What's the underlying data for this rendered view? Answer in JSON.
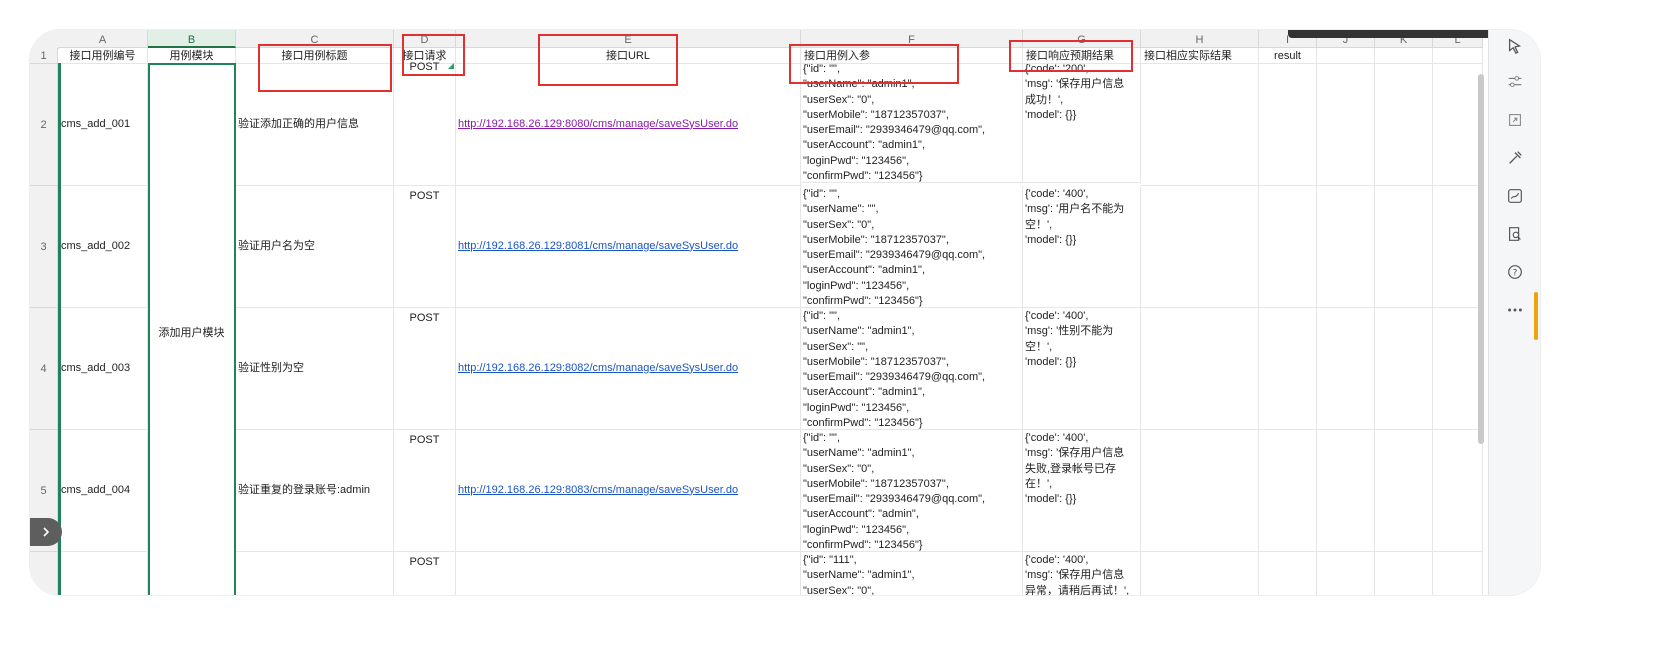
{
  "columns": [
    "A",
    "B",
    "C",
    "D",
    "E",
    "F",
    "G",
    "H",
    "I",
    "J",
    "K",
    "L"
  ],
  "header_row": {
    "row_num": "1",
    "A": "接口用例编号",
    "B": "用例模块",
    "C": "接口用例标题",
    "D": "接口请求",
    "E": "接口URL",
    "F": "接口用例入参",
    "G": "接口响应预期结果",
    "H": "接口相应实际结果",
    "I": "result"
  },
  "module_label": "添加用户模块",
  "rows": [
    {
      "row_num": "2",
      "id": "cms_add_001",
      "title": "验证添加正确的用户信息",
      "method": "POST",
      "url": "http://192.168.26.129:8080/cms/manage/saveSysUser.do",
      "params": "{\"id\": \"\",\n\"userName\": \"admin1\",\n\"userSex\": \"0\",\n\"userMobile\": \"18712357037\",\n\"userEmail\": \"2939346479@qq.com\",\n\"userAccount\": \"admin1\",\n\"loginPwd\": \"123456\",\n\"confirmPwd\": \"123456\"}",
      "expected": "{'code': '200',\n'msg': '保存用户信息\n成功！',\n'model': {}}"
    },
    {
      "row_num": "3",
      "id": "cms_add_002",
      "title": "验证用户名为空",
      "method": "POST",
      "url": "http://192.168.26.129:8081/cms/manage/saveSysUser.do",
      "params": "{\"id\": \"\",\n\"userName\": \"\",\n\"userSex\": \"0\",\n\"userMobile\": \"18712357037\",\n\"userEmail\": \"2939346479@qq.com\",\n\"userAccount\": \"admin1\",\n\"loginPwd\": \"123456\",\n\"confirmPwd\": \"123456\"}",
      "expected": "{'code': '400',\n'msg': '用户名不能为\n空！',\n'model': {}}"
    },
    {
      "row_num": "4",
      "id": "cms_add_003",
      "title": "验证性别为空",
      "method": "POST",
      "url": "http://192.168.26.129:8082/cms/manage/saveSysUser.do",
      "params": "{\"id\": \"\",\n\"userName\": \"admin1\",\n\"userSex\": \"\",\n\"userMobile\": \"18712357037\",\n\"userEmail\": \"2939346479@qq.com\",\n\"userAccount\": \"admin1\",\n\"loginPwd\": \"123456\",\n\"confirmPwd\": \"123456\"}",
      "expected": "{'code': '400',\n'msg': '性别不能为\n空！',\n'model': {}}"
    },
    {
      "row_num": "5",
      "id": "cms_add_004",
      "title": "验证重复的登录账号:admin",
      "method": "POST",
      "url": "http://192.168.26.129:8083/cms/manage/saveSysUser.do",
      "params": "{\"id\": \"\",\n\"userName\": \"admin1\",\n\"userSex\": \"0\",\n\"userMobile\": \"18712357037\",\n\"userEmail\": \"2939346479@qq.com\",\n\"userAccount\": \"admin\",\n\"loginPwd\": \"123456\",\n\"confirmPwd\": \"123456\"}",
      "expected": "{'code': '400',\n'msg': '保存用户信息\n失败,登录帐号已存\n在！',\n'model': {}}"
    },
    {
      "row_num": "",
      "id": "",
      "title": "",
      "method": "POST",
      "url": "",
      "params": "{\"id\": \"111\",\n\"userName\": \"admin1\",\n\"userSex\": \"0\",",
      "expected": "{'code': '400',\n'msg': '保存用户信息\n异常，请稍后再试！',"
    }
  ],
  "colors": {
    "selection_green": "#21835a",
    "annotation_red": "#e03030",
    "link_blue": "#1a55c4",
    "link_visited": "#8a1aa8"
  },
  "toolbar_icons": [
    "cursor-select-icon",
    "adjust-sliders-icon",
    "resize-icon",
    "tools-icon",
    "signature-icon",
    "book-search-icon",
    "help-icon",
    "more-icon"
  ]
}
